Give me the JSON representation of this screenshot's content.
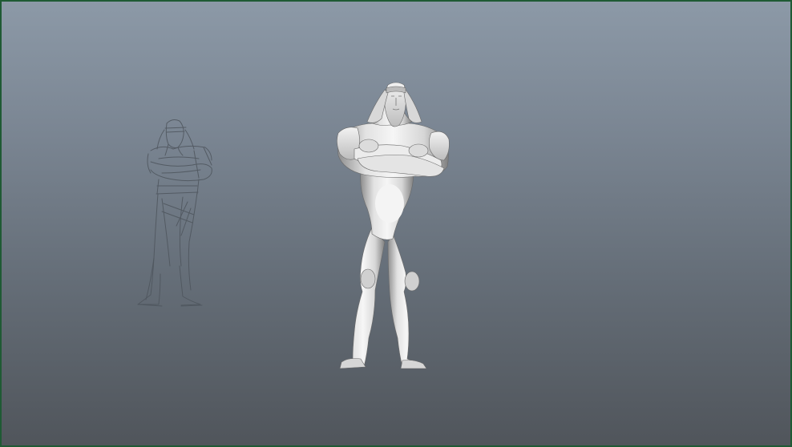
{
  "viewport": {
    "border_color": "#1f5a34",
    "gradient_top": "#8c99a7",
    "gradient_bottom": "#50555b"
  },
  "objects": [
    {
      "id": "reference-sketch",
      "kind": "image-plane",
      "icon": "pencil-sketch"
    },
    {
      "id": "character-model",
      "kind": "mesh",
      "icon": "3d-character"
    }
  ]
}
